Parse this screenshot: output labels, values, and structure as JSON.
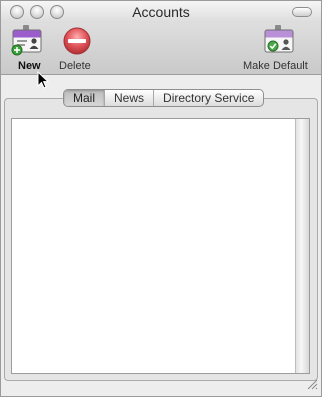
{
  "window": {
    "title": "Accounts"
  },
  "toolbar": {
    "new_label": "New",
    "delete_label": "Delete",
    "make_default_label": "Make Default"
  },
  "tabs": [
    {
      "label": "Mail",
      "active": true
    },
    {
      "label": "News",
      "active": false
    },
    {
      "label": "Directory Service",
      "active": false
    }
  ],
  "colors": {
    "card_band": "#9b5ccc",
    "delete_red": "#e0545a",
    "add_green": "#3aa23a",
    "check_green": "#4aa84a"
  }
}
